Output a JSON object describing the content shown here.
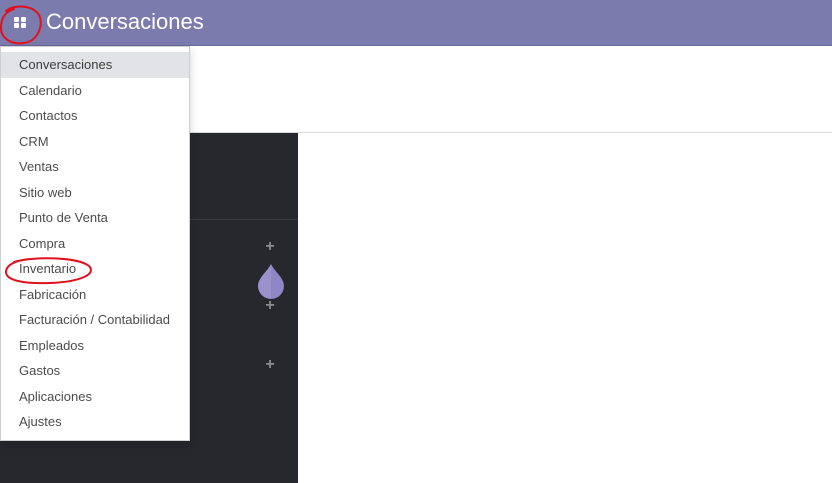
{
  "header": {
    "title": "Conversaciones",
    "apps_icon": "grid-icon",
    "background_color": "#7c7bad"
  },
  "apps_menu": {
    "items": [
      {
        "label": "Conversaciones",
        "active": true
      },
      {
        "label": "Calendario"
      },
      {
        "label": "Contactos"
      },
      {
        "label": "CRM"
      },
      {
        "label": "Ventas"
      },
      {
        "label": "Sitio web"
      },
      {
        "label": "Punto de Venta"
      },
      {
        "label": "Compra"
      },
      {
        "label": "Inventario"
      },
      {
        "label": "Fabricación"
      },
      {
        "label": "Facturación / Contabilidad"
      },
      {
        "label": "Empleados"
      },
      {
        "label": "Gastos"
      },
      {
        "label": "Aplicaciones"
      },
      {
        "label": "Ajustes"
      }
    ]
  },
  "sidebar": {
    "background_color": "#26282d",
    "add_icon": "plus-icon"
  },
  "annotations": {
    "color": "#e0101e",
    "highlighted_items": [
      "apps-toggle",
      "Inventario"
    ]
  }
}
